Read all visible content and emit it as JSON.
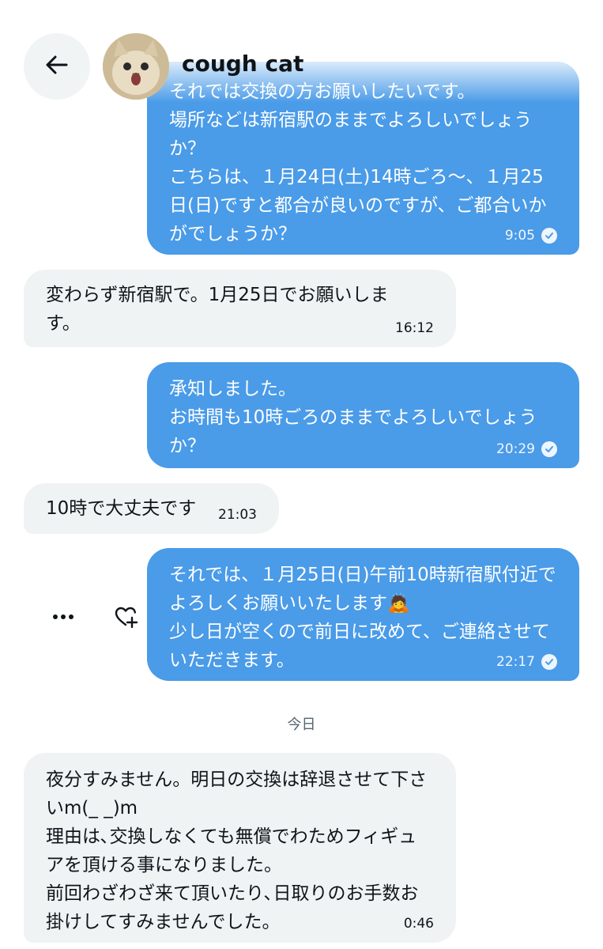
{
  "header": {
    "contact_name": "cough cat",
    "back_icon": "arrow-left-icon",
    "avatar_icon": "cat-avatar"
  },
  "messages": [
    {
      "id": "m1",
      "direction": "outgoing",
      "text": "それでは交換の方お願いしたいです。\n場所などは新宿駅のままでよろしいでしょうか？\nこちらは、１月24日(土)14時ごろ〜、１月25日(日)ですと都合が良いのですが、ご都合いかがでしょうか？",
      "time": "9:05",
      "read": true
    },
    {
      "id": "m2",
      "direction": "incoming",
      "text": "変わらず新宿駅で。1月25日でお願いします。",
      "time": "16:12"
    },
    {
      "id": "m3",
      "direction": "outgoing",
      "text": "承知しました。\nお時間も10時ごろのままでよろしいでしょうか？",
      "time": "20:29",
      "read": true
    },
    {
      "id": "m4",
      "direction": "incoming",
      "text": "10時で大丈夫です",
      "time": "21:03"
    },
    {
      "id": "m5",
      "direction": "outgoing",
      "text": "それでは、１月25日(日)午前10時新宿駅付近でよろしくお願いいたします🙇\n少し日が空くので前日に改めて、ご連絡させていただきます。",
      "time": "22:17",
      "read": true
    },
    {
      "id": "m6",
      "direction": "incoming",
      "text": "夜分すみません。明日の交換は辞退させて下さいm(_ _)m\n理由は､交換しなくても無償でわためフィギュアを頂ける事になりました。\n前回わざわざ来て頂いたり､日取りのお手数お掛けしてすみませんでした。",
      "time": "0:46"
    }
  ],
  "message_actions": {
    "more_icon": "more-horizontal-icon",
    "react_icon": "heart-plus-icon"
  },
  "day_separator": "今日",
  "colors": {
    "outgoing_bubble": "#4a9be8",
    "incoming_bubble": "#eff3f4",
    "secondary_text": "#536471"
  }
}
